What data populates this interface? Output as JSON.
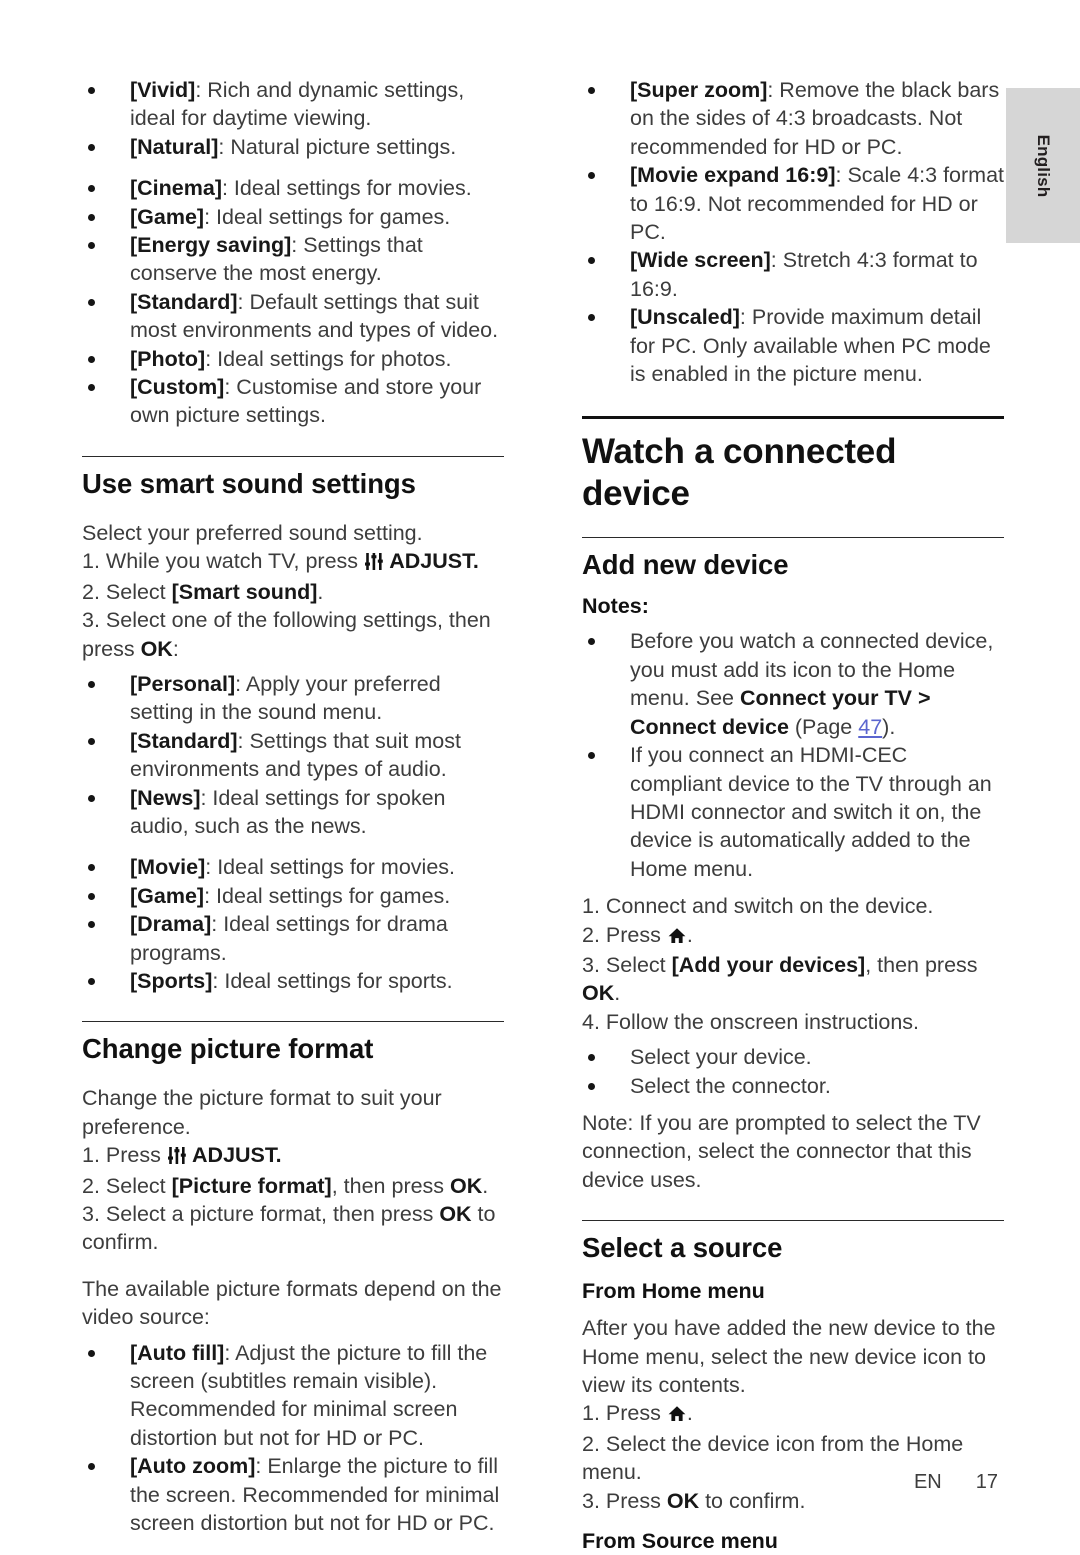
{
  "page": {
    "language_tab": "English",
    "footer": {
      "locale": "EN",
      "page_number": "17"
    },
    "link_color": "#5b66cf",
    "tab_color": "#d6d6d6"
  },
  "left_column": {
    "smart_picture_bullets": [
      {
        "term": "[Vivid]",
        "desc": ": Rich and dynamic settings, ideal for daytime viewing."
      },
      {
        "term": "[Natural]",
        "desc": ": Natural picture settings."
      },
      {
        "term": "[Cinema]",
        "desc": ": Ideal settings for movies."
      },
      {
        "term": "[Game]",
        "desc": ": Ideal settings for games."
      },
      {
        "term": "[Energy saving]",
        "desc": ": Settings that conserve the most energy."
      },
      {
        "term": "[Standard]",
        "desc": ": Default settings that suit most environments and types of video."
      },
      {
        "term": "[Photo]",
        "desc": ": Ideal settings for photos."
      },
      {
        "term": "[Custom]",
        "desc": ": Customise and store your own picture settings."
      }
    ],
    "smart_sound": {
      "heading": "Use smart sound settings",
      "intro": "Select your preferred sound setting.",
      "step1_a": "1. While you watch TV, press ",
      "step1_icon": "adjust-icon",
      "step1_b": " ADJUST.",
      "step2_a": "2. Select ",
      "step2_bold": "[Smart sound]",
      "step2_b": ".",
      "step3_a": "3. Select one of the following settings, then press ",
      "step3_bold": "OK",
      "step3_b": ":",
      "bullets": [
        {
          "term": "[Personal]",
          "desc": ": Apply your preferred setting in the sound menu."
        },
        {
          "term": "[Standard]",
          "desc": ": Settings that suit most environments and types of audio."
        },
        {
          "term": "[News]",
          "desc": ": Ideal settings for spoken audio, such as the news."
        },
        {
          "term": "[Movie]",
          "desc": ": Ideal settings for movies."
        },
        {
          "term": "[Game]",
          "desc": ": Ideal settings for games."
        },
        {
          "term": "[Drama]",
          "desc": ": Ideal settings for drama programs."
        },
        {
          "term": "[Sports]",
          "desc": ": Ideal settings for sports."
        }
      ]
    },
    "picture_format": {
      "heading": "Change picture format",
      "intro": "Change the picture format to suit your preference.",
      "step1_a": "1. Press ",
      "step1_icon": "adjust-icon",
      "step1_b": " ADJUST.",
      "step2_a": "2. Select ",
      "step2_bold": "[Picture format]",
      "step2_mid": ", then press ",
      "step2_bold2": "OK",
      "step2_b": ".",
      "step3_a": "3. Select a picture format, then press ",
      "step3_bold": "OK",
      "step3_b": " to confirm.",
      "depends": "The available picture formats depend on the video source:",
      "bullets": [
        {
          "term": "[Auto fill]",
          "desc": ": Adjust the picture to fill the screen (subtitles remain visible). Recommended for minimal screen distortion but not for HD or PC."
        },
        {
          "term": "[Auto zoom]",
          "desc": ": Enlarge the picture to fill the screen. Recommended for minimal screen distortion but not for HD or PC."
        }
      ]
    }
  },
  "right_column": {
    "format_bullets": [
      {
        "term": "[Super zoom]",
        "desc": ": Remove the black bars on the sides of 4:3 broadcasts. Not recommended for HD or PC."
      },
      {
        "term": "[Movie expand 16:9]",
        "desc": ": Scale 4:3 format to 16:9. Not recommended for HD or PC."
      },
      {
        "term": "[Wide screen]",
        "desc": ": Stretch 4:3 format to 16:9."
      },
      {
        "term": "[Unscaled]",
        "desc": ": Provide maximum detail for PC. Only available when PC mode is enabled in the picture menu."
      }
    ],
    "chapter_title": "Watch a connected device",
    "add_new_device": {
      "heading": "Add new device",
      "notes_label": "Notes:",
      "note1_a": "Before you watch a connected device, you must add its icon to the Home menu. See ",
      "note1_bold": "Connect your TV > Connect device",
      "note1_mid": " (Page ",
      "note1_link": "47",
      "note1_b": ").",
      "note2": "If you connect an HDMI-CEC compliant device to the TV through an HDMI connector and switch it on, the device is automatically added to the Home menu.",
      "step1": "1. Connect and switch on the device.",
      "step2_a": "2. Press ",
      "step2_icon": "home-icon",
      "step2_b": ".",
      "step3_a": "3. Select ",
      "step3_bold": "[Add your devices]",
      "step3_mid": ", then press ",
      "step3_bold2": "OK",
      "step3_b": ".",
      "step4": "4. Follow the onscreen instructions.",
      "sub_bullets": [
        "Select your device.",
        "Select the connector."
      ],
      "note_final": "Note: If you are prompted to select the TV connection, select the connector that this device uses."
    },
    "select_source": {
      "heading": "Select a source",
      "from_home_heading": "From Home menu",
      "from_home_intro": "After you have added the new device to the Home menu, select the new device icon to view its contents.",
      "step1_a": "1. Press ",
      "step1_icon": "home-icon",
      "step1_b": ".",
      "step2": "2. Select the device icon from the Home menu.",
      "step3_a": "3. Press ",
      "step3_bold": "OK",
      "step3_b": " to confirm.",
      "from_source_heading": "From Source menu"
    }
  }
}
